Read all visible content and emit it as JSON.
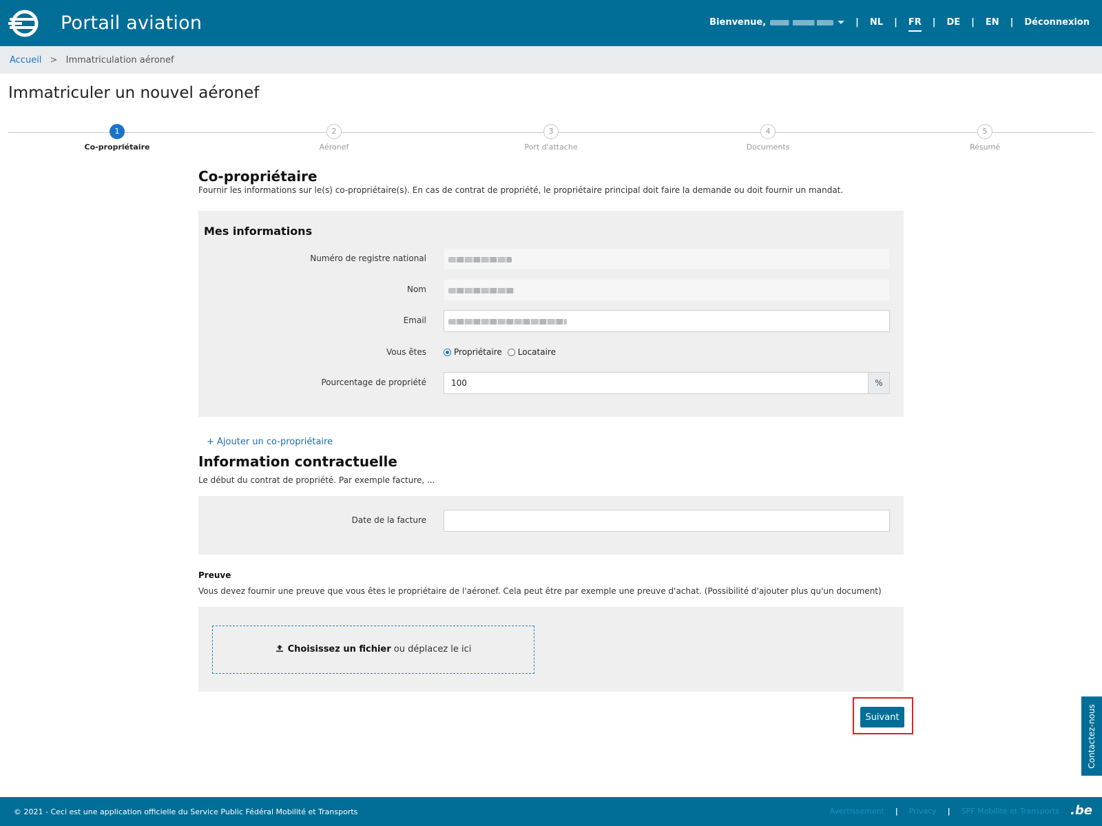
{
  "header": {
    "title": "Portail aviation",
    "welcome": "Bienvenue,",
    "languages": [
      "NL",
      "FR",
      "DE",
      "EN"
    ],
    "active_language": "FR",
    "logout": "Déconnexion"
  },
  "breadcrumb": {
    "home": "Accueil",
    "separator": ">",
    "current": "Immatriculation aéronef"
  },
  "page_title": "Immatriculer un nouvel aéronef",
  "steps": [
    {
      "num": "1",
      "label": "Co-propriétaire"
    },
    {
      "num": "2",
      "label": "Aéronef"
    },
    {
      "num": "3",
      "label": "Port d'attache"
    },
    {
      "num": "4",
      "label": "Documents"
    },
    {
      "num": "5",
      "label": "Résumé"
    }
  ],
  "co_owner": {
    "title": "Co-propriétaire",
    "description": "Fournir les informations sur le(s) co-propriétaire(s). En cas de contrat de propriété, le propriétaire principal doit faire la demande ou doit fournir un mandat.",
    "panel_title": "Mes informations",
    "fields": {
      "national_number_label": "Numéro de registre national",
      "name_label": "Nom",
      "email_label": "Email",
      "role_label": "Vous êtes",
      "role_owner": "Propriétaire",
      "role_tenant": "Locataire",
      "percentage_label": "Pourcentage de propriété",
      "percentage_value": "100",
      "percentage_unit": "%"
    },
    "add_link": "+ Ajouter un co-propriétaire"
  },
  "contract": {
    "title": "Information contractuelle",
    "description": "Le début du contrat de propriété. Par exemple facture, ...",
    "invoice_date_label": "Date de la facture",
    "invoice_date_value": ""
  },
  "proof": {
    "title": "Preuve",
    "description": "Vous devez fournir une preuve que vous êtes le propriétaire de l'aéronef. Cela peut être par exemple une preuve d'achat. (Possibilité d'ajouter plus qu'un document)",
    "choose_file": "Choisissez un fichier",
    "drop_text": "ou déplacez le ici"
  },
  "next_button": "Suivant",
  "contact_tab": "Contactez-nous",
  "footer": {
    "copyright": "© 2021 - Ceci est une application officielle du Service Public Fédéral Mobilité et Transports",
    "links": [
      "Avertissement",
      "Privacy",
      "SPF Mobilité et Transports"
    ],
    "be_logo": ".be"
  },
  "colors": {
    "brand": "#006e97",
    "accent": "#1a73c8",
    "panel": "#efefef",
    "highlight": "#e02020"
  }
}
